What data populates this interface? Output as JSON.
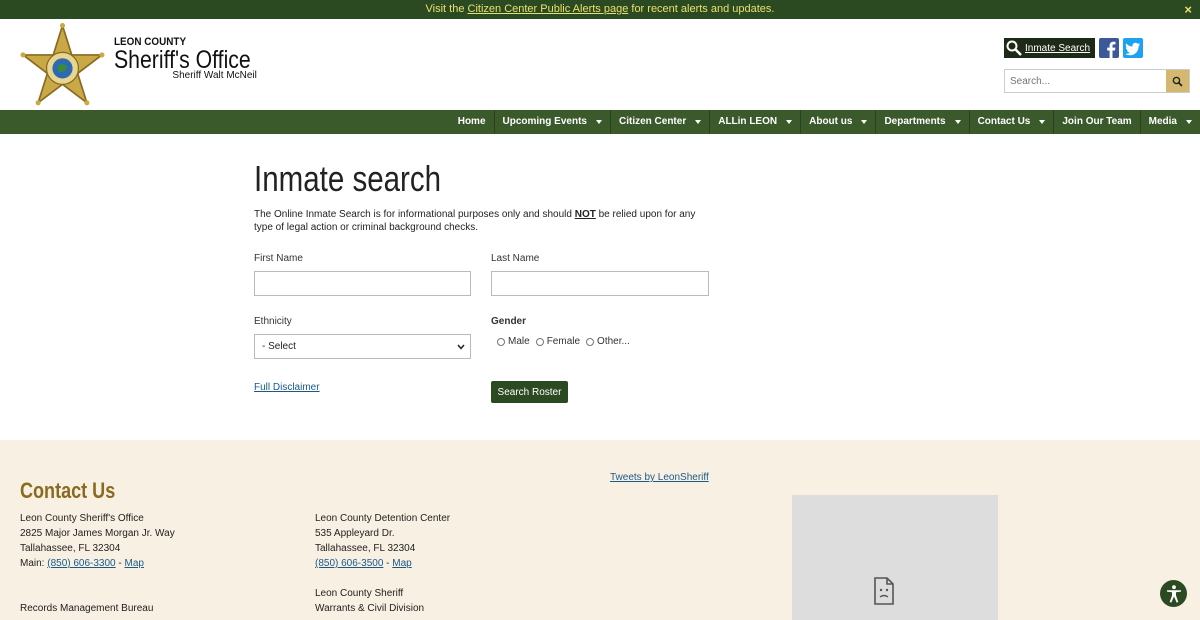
{
  "alert": {
    "prefix": "Visit the ",
    "link": "Citizen Center Public Alerts page",
    "suffix": " for recent alerts and updates.",
    "close": "×"
  },
  "brand": {
    "line1": "LEON COUNTY",
    "line2": "Sheriff's Office",
    "line3": "Sheriff Walt McNeil"
  },
  "header": {
    "inmate_search": "Inmate Search",
    "search_placeholder": "Search..."
  },
  "nav": [
    "Home",
    "Upcoming Events",
    "Citizen Center",
    "ALLin LEON",
    "About us",
    "Departments",
    "Contact Us",
    "Join Our Team",
    "Media"
  ],
  "nav_caret": [
    false,
    true,
    true,
    true,
    true,
    true,
    true,
    false,
    true
  ],
  "main": {
    "title": "Inmate search",
    "intro_a": "The Online Inmate Search is for informational purposes only and should ",
    "intro_b": "NOT",
    "intro_c": " be relied upon for any type of legal action or criminal background checks.",
    "first_name_label": "First Name",
    "last_name_label": "Last Name",
    "ethnicity_label": "Ethnicity",
    "ethnicity_value": "- Select",
    "gender_label": "Gender",
    "gender_options": [
      "Male",
      "Female",
      "Other..."
    ],
    "disclaimer": "Full Disclaimer",
    "search_button": "Search Roster"
  },
  "footer": {
    "title": "Contact Us",
    "office": {
      "name": "Leon County Sheriff's Office",
      "street": "2825 Major James Morgan Jr. Way",
      "city": "Tallahassee, FL 32304",
      "main_label": "Main: ",
      "phone": "(850) 606-3300",
      "sep": " - ",
      "map": "Map"
    },
    "records": "Records Management Bureau",
    "detention": {
      "name": "Leon County Detention Center",
      "street": "535 Appleyard Dr.",
      "city": "Tallahassee, FL 32304",
      "phone": "(850) 606-3500",
      "sep": " - ",
      "map": "Map"
    },
    "warrants_l1": "Leon County Sheriff",
    "warrants_l2": "Warrants & Civil Division",
    "tweets": "Tweets by LeonSheriff"
  },
  "colors": {
    "dark_green": "#2c4a22",
    "nav_green": "#3a5a2c",
    "gold": "#8a6a20",
    "footer_bg": "#f8f0e2",
    "link": "#1a5a8a"
  }
}
